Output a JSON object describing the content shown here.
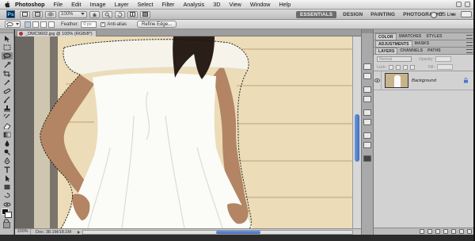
{
  "menubar": {
    "app_name": "Photoshop",
    "items": [
      "File",
      "Edit",
      "Image",
      "Layer",
      "Select",
      "Filter",
      "Analysis",
      "3D",
      "View",
      "Window",
      "Help"
    ]
  },
  "appbar": {
    "logo": "Ps",
    "zoom": "100%",
    "workspaces": [
      "ESSENTIALS",
      "DESIGN",
      "PAINTING",
      "PHOTOGRAPHY"
    ],
    "active_workspace": "ESSENTIALS",
    "more": "»",
    "cs_live": "CS Live"
  },
  "options": {
    "feather_label": "Feather:",
    "feather_value": "0 px",
    "antialias_label": "Anti-alias",
    "refine_edge": "Refine Edge..."
  },
  "document": {
    "tab_title": "_DMC9602.jpg @ 100% (RGB/8*)",
    "zoom": "100%",
    "doc_size": "Doc: 38.1M/18.1M"
  },
  "panels": {
    "tabs_top": [
      "COLOR",
      "SWATCHES",
      "STYLES"
    ],
    "active_top": "COLOR",
    "tabs_mid": [
      "ADJUSTMENTS",
      "MASKS"
    ],
    "active_mid": "ADJUSTMENTS",
    "tabs_layers": [
      "LAYERS",
      "CHANNELS",
      "PATHS"
    ],
    "active_layers": "LAYERS",
    "blend_mode": "Normal",
    "opacity_label": "Opacity:",
    "lock_label": "Lock:",
    "fill_label": "Fill:",
    "layer_name": "Background"
  },
  "colors": {
    "accent": "#3f6fc3",
    "panel": "#d2d2d2",
    "wall": "#ead9b4"
  }
}
